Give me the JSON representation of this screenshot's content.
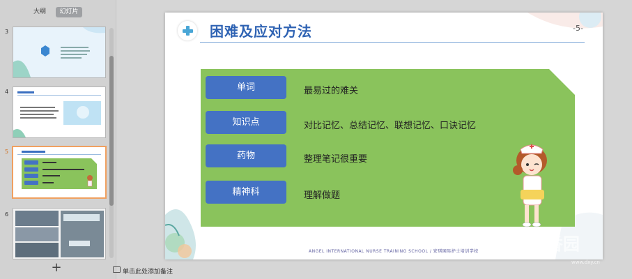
{
  "sidebar": {
    "tabs": [
      "大纲",
      "幻灯片"
    ],
    "slide_numbers": [
      "3",
      "4",
      "5",
      "6"
    ],
    "add_slide": "+"
  },
  "slide": {
    "title": "困难及应对方法",
    "number": "-5-",
    "rows": [
      {
        "label": "单词",
        "desc": "最易过的难关"
      },
      {
        "label": "知识点",
        "desc": "对比记忆、总结记忆、联想记忆、口诀记忆"
      },
      {
        "label": "药物",
        "desc": "整理笔记很重要"
      },
      {
        "label": "精神科",
        "desc": "理解做题"
      }
    ],
    "footer": "ANGEL INTERNATIONAL NURSE TRAINING SCHOOL / 安琪国际护士培训学校"
  },
  "notes": {
    "placeholder": "单击此处添加备注"
  },
  "watermark": {
    "text": "丁香园",
    "url": "www.dxy.cn"
  },
  "colors": {
    "accent_blue": "#4472c4",
    "panel_green": "#8ac35c",
    "title_blue": "#2f63b3"
  }
}
